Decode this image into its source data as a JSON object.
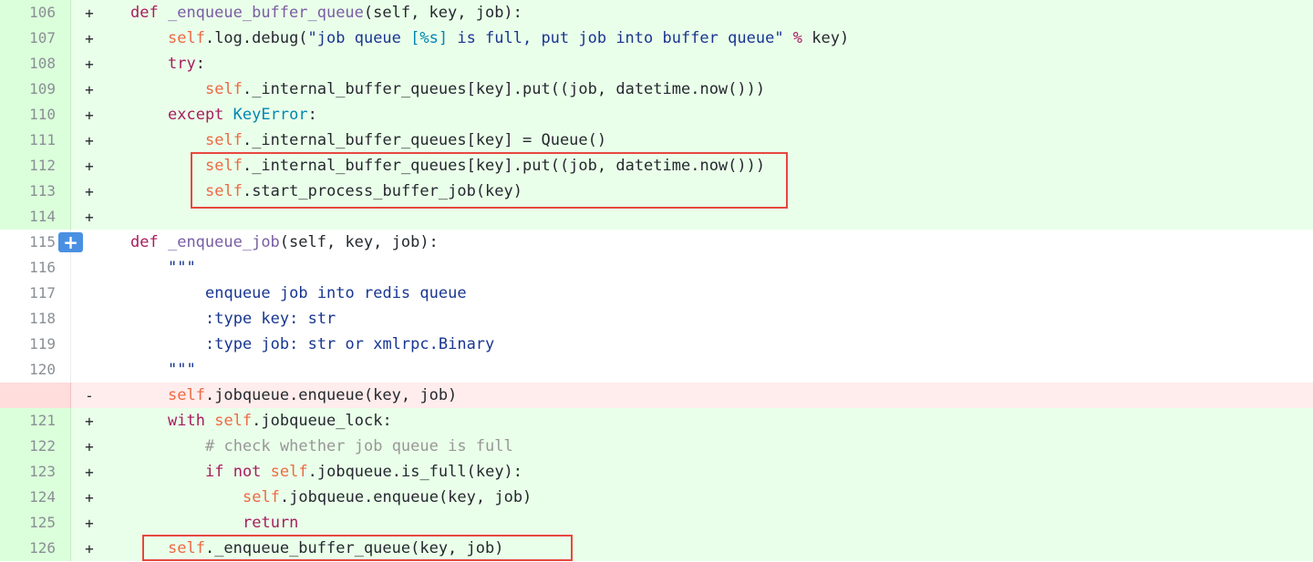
{
  "rows": [
    {
      "num": "106",
      "sign": "+",
      "type": "add"
    },
    {
      "num": "107",
      "sign": "+",
      "type": "add"
    },
    {
      "num": "108",
      "sign": "+",
      "type": "add"
    },
    {
      "num": "109",
      "sign": "+",
      "type": "add"
    },
    {
      "num": "110",
      "sign": "+",
      "type": "add"
    },
    {
      "num": "111",
      "sign": "+",
      "type": "add"
    },
    {
      "num": "112",
      "sign": "+",
      "type": "add"
    },
    {
      "num": "113",
      "sign": "+",
      "type": "add"
    },
    {
      "num": "114",
      "sign": "+",
      "type": "add"
    },
    {
      "num": "115",
      "sign": "",
      "type": "ctx"
    },
    {
      "num": "116",
      "sign": "",
      "type": "ctx"
    },
    {
      "num": "117",
      "sign": "",
      "type": "ctx"
    },
    {
      "num": "118",
      "sign": "",
      "type": "ctx"
    },
    {
      "num": "119",
      "sign": "",
      "type": "ctx"
    },
    {
      "num": "120",
      "sign": "",
      "type": "ctx"
    },
    {
      "num": "",
      "sign": "-",
      "type": "del"
    },
    {
      "num": "121",
      "sign": "+",
      "type": "add"
    },
    {
      "num": "122",
      "sign": "+",
      "type": "add"
    },
    {
      "num": "123",
      "sign": "+",
      "type": "add"
    },
    {
      "num": "124",
      "sign": "+",
      "type": "add"
    },
    {
      "num": "125",
      "sign": "+",
      "type": "add"
    },
    {
      "num": "126",
      "sign": "+",
      "type": "add"
    }
  ],
  "code": {
    "l106": {
      "def": "def",
      "name": "_enqueue_buffer_queue",
      "rest": "(self, key, job):"
    },
    "l107": {
      "self": "self",
      "a": ".log.debug(",
      "s1": "\"job queue ",
      "esc": "[%s]",
      "s2": " is full, put job into buffer queue\"",
      "op": " % ",
      "b": "key)"
    },
    "l108": {
      "kw": "try",
      "rest": ":"
    },
    "l109": {
      "self": "self",
      "rest": "._internal_buffer_queues[key].put((job, datetime.now()))"
    },
    "l110": {
      "kw": "except",
      "cls": "KeyError",
      "rest": ":"
    },
    "l111": {
      "self": "self",
      "rest": "._internal_buffer_queues[key] = Queue()"
    },
    "l112": {
      "self": "self",
      "rest": "._internal_buffer_queues[key].put((job, datetime.now()))"
    },
    "l113": {
      "self": "self",
      "rest": ".start_process_buffer_job(key)"
    },
    "l114": {
      "rest": ""
    },
    "l115": {
      "def": "def",
      "name": "_enqueue_job",
      "rest": "(self, key, job):"
    },
    "l116": {
      "str": "\"\"\""
    },
    "l117": {
      "str": "enqueue job into redis queue"
    },
    "l118": {
      "str": ":type key: str"
    },
    "l119": {
      "str": ":type job: str or xmlrpc.Binary"
    },
    "l120": {
      "str": "\"\"\""
    },
    "ldel": {
      "self": "self",
      "rest": ".jobqueue.enqueue(key, job)"
    },
    "l121": {
      "kw": "with",
      "self": "self",
      "rest": ".jobqueue_lock:"
    },
    "l122": {
      "cm": "# check whether job queue is full"
    },
    "l123": {
      "kw": "if not",
      "self": "self",
      "rest": ".jobqueue.is_full(key):"
    },
    "l124": {
      "self": "self",
      "rest": ".jobqueue.enqueue(key, job)"
    },
    "l125": {
      "kw": "return"
    },
    "l126": {
      "self": "self",
      "rest": "._enqueue_buffer_queue(key, job)"
    }
  },
  "expand_icon": "plus-icon",
  "colors": {
    "add_bg": "#eaffea",
    "del_bg": "#ffecec",
    "highlight": "#e8473f",
    "expand_button": "#4a90e2"
  }
}
